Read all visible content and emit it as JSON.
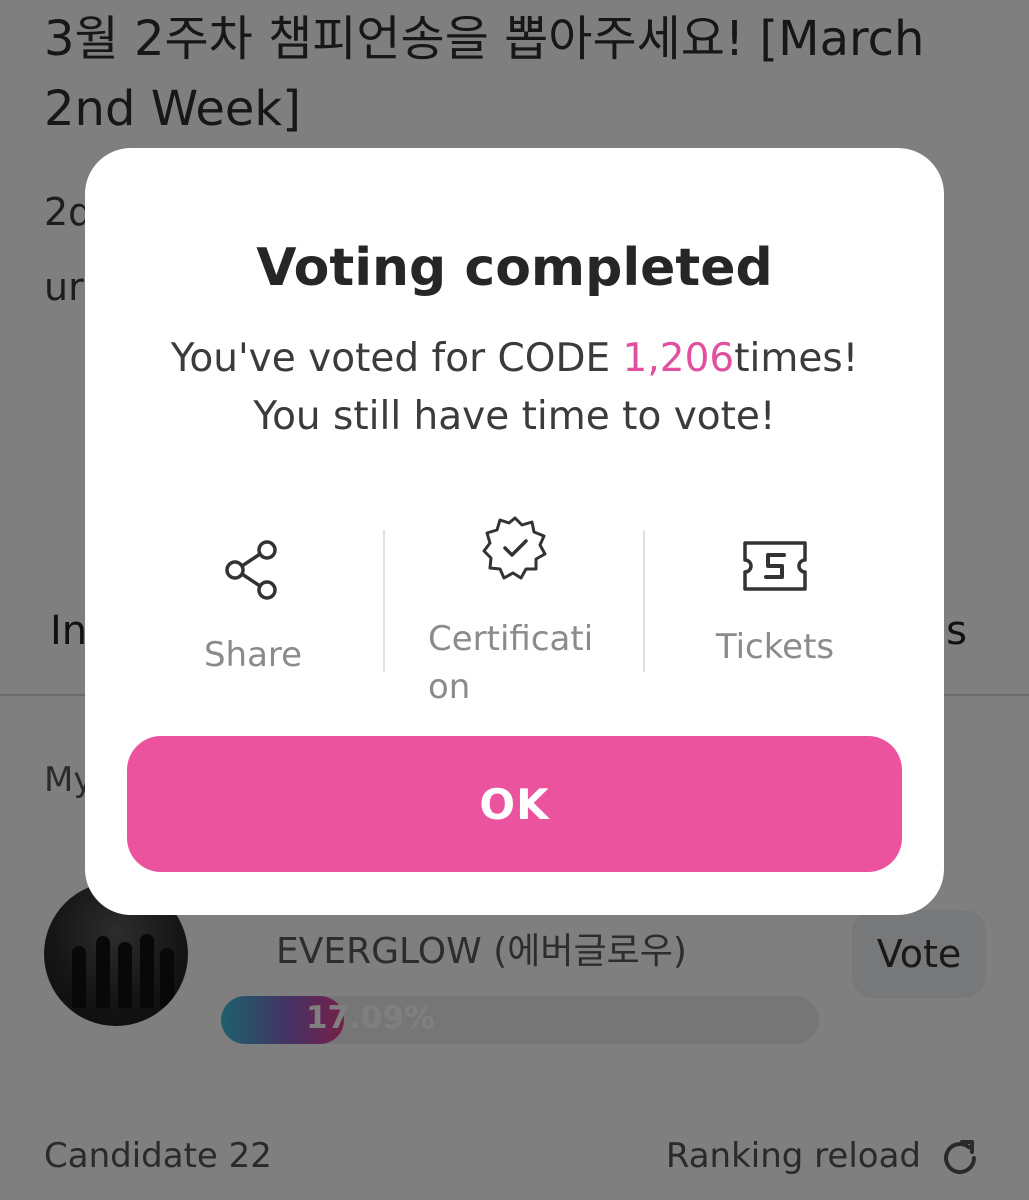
{
  "page": {
    "title": "3월 2주차 챔피언송을 뽑아주세요! [March 2nd Week]",
    "desc_line1": "2d",
    "desc_line2": "ur",
    "tab_left": "In",
    "tab_right": "s",
    "my_vote_label": "My"
  },
  "candidate": {
    "name": "EVERGLOW (에버글로우)",
    "percent": 17.09,
    "percent_label": "17.09%",
    "vote_label": "Vote"
  },
  "footer": {
    "candidate_count": "Candidate 22",
    "ranking_reload": "Ranking reload"
  },
  "modal": {
    "title": "Voting completed",
    "msg_prefix": "You've voted for CODE ",
    "vote_count": "1,206",
    "msg_suffix": "times!",
    "msg_line2": "You still have time to vote!",
    "actions": [
      {
        "label": "Share",
        "icon": "share-icon"
      },
      {
        "label": "Certification",
        "icon": "certification-badge-icon"
      },
      {
        "label": "Tickets",
        "icon": "ticket-icon"
      }
    ],
    "ok_label": "OK"
  },
  "colors": {
    "accent": "#ec539f",
    "count_highlight": "#e0509f",
    "overlay": "rgba(0,0,0,0.5)"
  }
}
